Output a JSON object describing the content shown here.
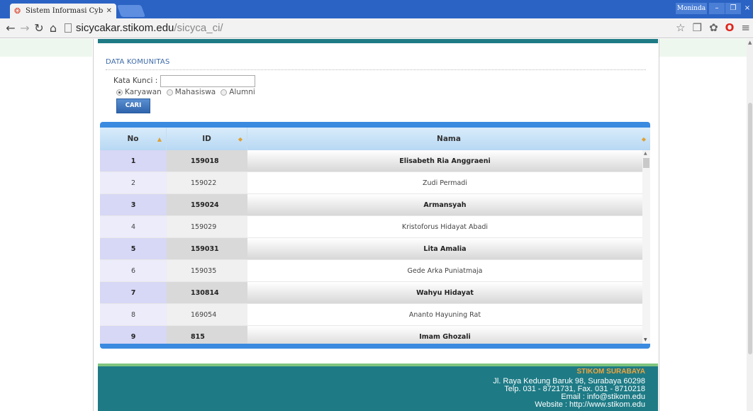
{
  "browser": {
    "tab_title": "Sistem Informasi Cyber Car",
    "tab_close": "✕",
    "profile_name": "Moninda",
    "url_host": "sicycakar.stikom.edu",
    "url_path": "/sicyca_ci/"
  },
  "search": {
    "section_title": "DATA KOMUNITAS",
    "keyword_label": "Kata Kunci :",
    "keyword_value": "",
    "options": [
      "Karyawan",
      "Mahasiswa",
      "Alumni"
    ],
    "selected_option": "Karyawan",
    "button_label": "CARI"
  },
  "table": {
    "columns": [
      "No",
      "ID",
      "Nama"
    ],
    "rows": [
      {
        "no": "1",
        "id": "159018",
        "nama": "Elisabeth Ria Anggraeni"
      },
      {
        "no": "2",
        "id": "159022",
        "nama": "Zudi Permadi"
      },
      {
        "no": "3",
        "id": "159024",
        "nama": "Armansyah"
      },
      {
        "no": "4",
        "id": "159029",
        "nama": "Kristoforus Hidayat Abadi"
      },
      {
        "no": "5",
        "id": "159031",
        "nama": "Lita Amalia"
      },
      {
        "no": "6",
        "id": "159035",
        "nama": "Gede Arka Puniatmaja"
      },
      {
        "no": "7",
        "id": "130814",
        "nama": "Wahyu Hidayat"
      },
      {
        "no": "8",
        "id": "169054",
        "nama": "Ananto Hayuning Rat"
      },
      {
        "no": "9",
        "id": "815",
        "nama": "Imam Ghozali"
      }
    ]
  },
  "footer": {
    "org": "STIKOM SURABAYA",
    "address": "Jl. Raya Kedung Baruk 98, Surabaya 60298",
    "phone": "Telp. 031 - 8721731, Fax. 031 - 8710218",
    "email": "Email : info@stikom.edu",
    "website": "Website : http://www.stikom.edu"
  },
  "colors": {
    "chrome_blue": "#2b63c4",
    "teal": "#1e7b86",
    "table_blue": "#3a8ae0",
    "footer_accent": "#f2a43a"
  }
}
